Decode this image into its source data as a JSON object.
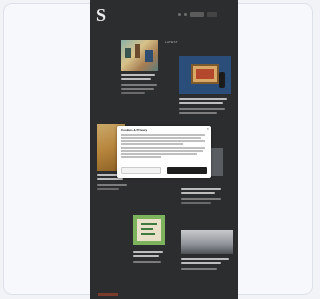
{
  "site": {
    "logo_letter": "S",
    "logo_subtitle": ""
  },
  "nav": {
    "section_label": "LATEST"
  },
  "cookie_dialog": {
    "title": "Cookies & Privacy",
    "close_icon": "close-icon",
    "link_text": "",
    "reject_label": "",
    "accept_label": ""
  },
  "colors": {
    "page_background": "#f1f3f7",
    "site_background": "#2c2d2f",
    "dialog_background": "#ffffff",
    "accept_button": "#1e1e1e"
  }
}
